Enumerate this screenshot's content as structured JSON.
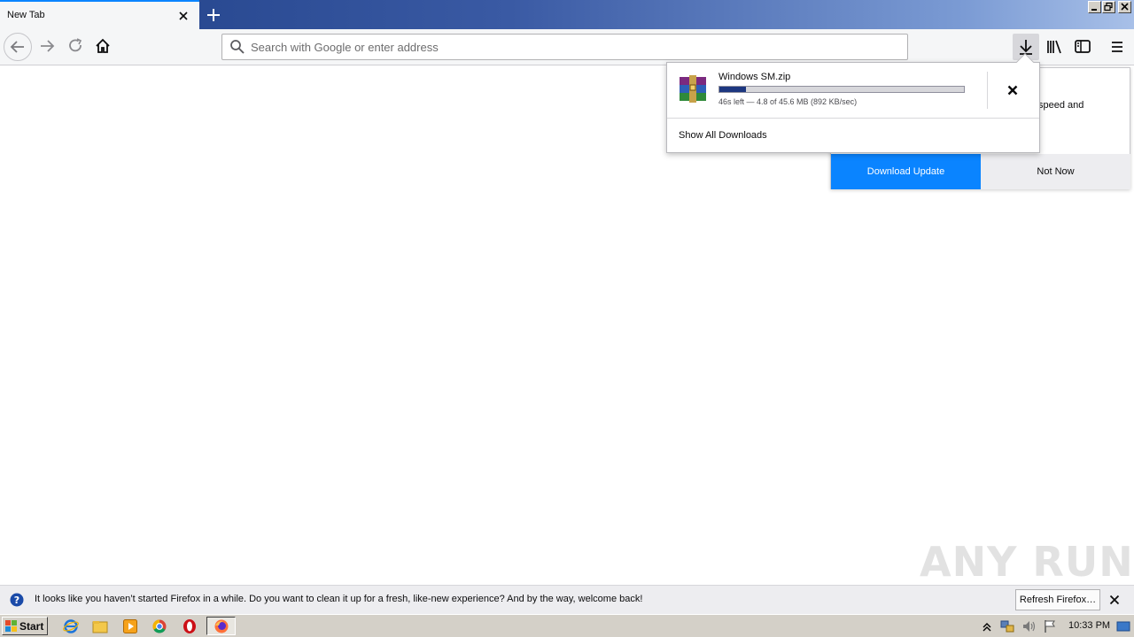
{
  "browser": {
    "tab_title": "New Tab",
    "url_placeholder": "Search with Google or enter address"
  },
  "downloads_panel": {
    "filename": "Windows SM.zip",
    "progress_fraction": 0.107,
    "status": "46s left — 4.8 of 45.6 MB (892 KB/sec)",
    "show_all_label": "Show All Downloads"
  },
  "update_panel": {
    "partial_text": "speed and",
    "download_update_label": "Download Update",
    "not_now_label": "Not Now"
  },
  "watermark": "ANY RUN",
  "notification": {
    "message": "It looks like you haven’t started Firefox in a while. Do you want to clean it up for a fresh, like-new experience? And by the way, welcome back!",
    "refresh_label": "Refresh Firefox…"
  },
  "taskbar": {
    "start_label": "Start",
    "clock": "10:33 PM"
  },
  "colors": {
    "accent": "#0a84ff",
    "progress": "#1d3780"
  }
}
